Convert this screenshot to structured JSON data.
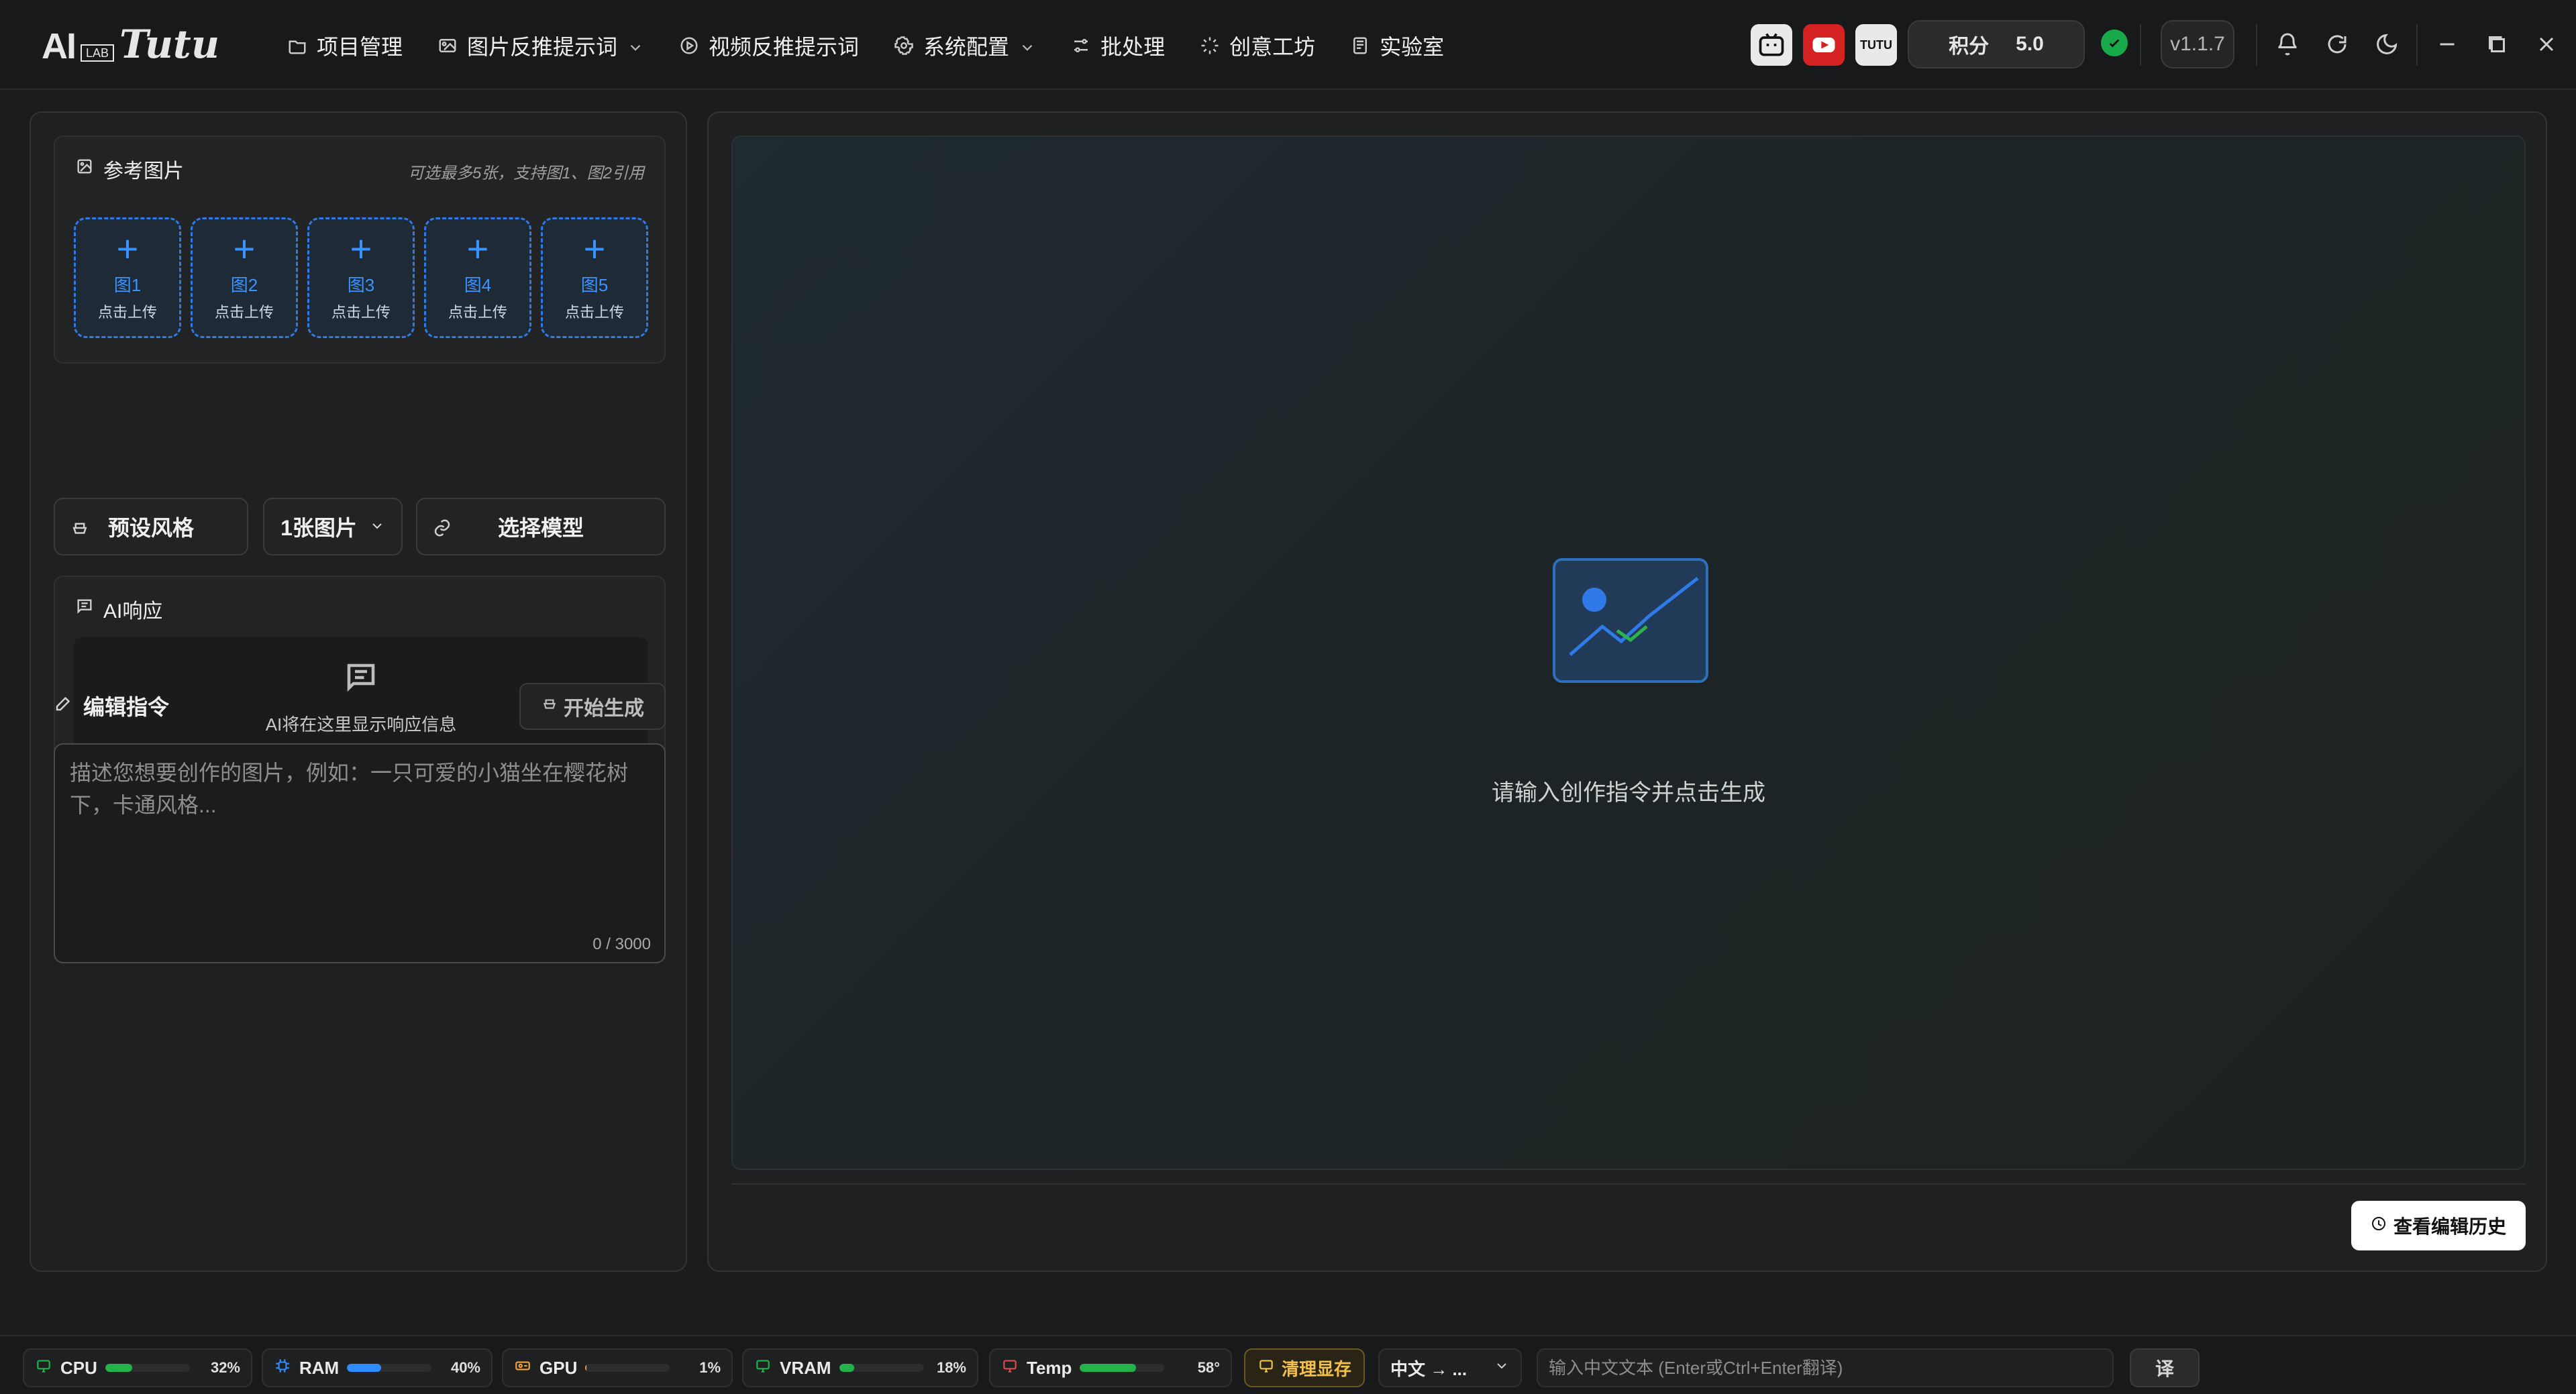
{
  "brand": {
    "ai": "AI",
    "lab": "LAB",
    "tutu": "Tutu"
  },
  "nav": [
    {
      "label": "项目管理",
      "icon": "folder-icon"
    },
    {
      "label": "图片反推提示词",
      "icon": "image-icon",
      "has_dropdown": true
    },
    {
      "label": "视频反推提示词",
      "icon": "play-circle-icon"
    },
    {
      "label": "系统配置",
      "icon": "gear-icon",
      "has_dropdown": true
    },
    {
      "label": "批处理",
      "icon": "sliders-icon"
    },
    {
      "label": "创意工坊",
      "icon": "sparkle-icon"
    },
    {
      "label": "实验室",
      "icon": "flask-icon"
    }
  ],
  "top_right": {
    "points_label": "积分",
    "points_value": "5.0",
    "version": "v1.1.7",
    "apps": [
      "bilibili-icon",
      "youtube-icon",
      "tutu-icon"
    ],
    "tools": [
      "bell-icon",
      "refresh-icon",
      "moon-icon",
      "minimize-icon",
      "maximize-icon",
      "close-icon"
    ]
  },
  "left": {
    "ref_title": "参考图片",
    "ref_hint": "可选最多5张，支持图1、图2引用",
    "slots": [
      {
        "title": "图1",
        "sub": "点击上传"
      },
      {
        "title": "图2",
        "sub": "点击上传"
      },
      {
        "title": "图3",
        "sub": "点击上传"
      },
      {
        "title": "图4",
        "sub": "点击上传"
      },
      {
        "title": "图5",
        "sub": "点击上传"
      }
    ],
    "preset_label": "预设风格",
    "count_label": "1张图片",
    "model_label": "选择模型",
    "ai_title": "AI响应",
    "ai_placeholder": "AI将在这里显示响应信息",
    "edit_title": "编辑指令",
    "start_label": "开始生成",
    "prompt_placeholder": "描述您想要创作的图片，例如：一只可爱的小猫坐在樱花树下，卡通风格...",
    "counter": "0 / 3000"
  },
  "right": {
    "empty_text": "请输入创作指令并点击生成",
    "history_label": "查看编辑历史"
  },
  "status": {
    "cpu": {
      "label": "CPU",
      "pct": "32%",
      "fill": 0.32,
      "color": "#24b24b"
    },
    "ram": {
      "label": "RAM",
      "pct": "40%",
      "fill": 0.4,
      "color": "#2d8cff"
    },
    "gpu": {
      "label": "GPU",
      "pct": "1%",
      "fill": 0.01,
      "color": "#f2a23b"
    },
    "vram": {
      "label": "VRAM",
      "pct": "18%",
      "fill": 0.18,
      "color": "#24b24b"
    },
    "temp": {
      "label": "Temp",
      "pct": "58°",
      "fill": 0.66,
      "color": "#24b24b"
    },
    "clean_label": "清理显存",
    "lang_label": "中文 → ...",
    "translate_placeholder": "输入中文文本 (Enter或Ctrl+Enter翻译)",
    "translate_btn": "译"
  },
  "colors": {
    "accent_blue": "#2d8cff",
    "success_green": "#18a94b",
    "warning_yellow": "#f2c14b"
  }
}
